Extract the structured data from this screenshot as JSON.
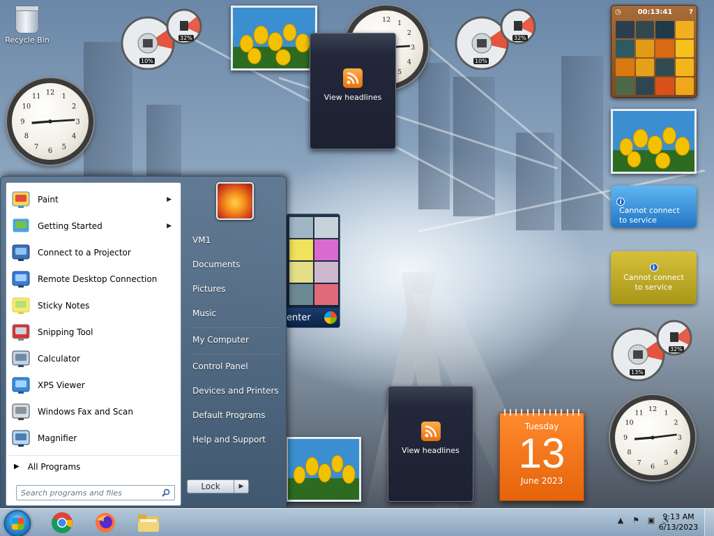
{
  "desktop": {
    "recycle_bin": "Recycle Bin"
  },
  "gadgets": {
    "meters": [
      {
        "cpu": "10%",
        "ram": "32%"
      },
      {
        "cpu": "10%",
        "ram": "32%"
      },
      {
        "cpu": "13%",
        "ram": "32%"
      }
    ],
    "feed_top": "View headlines",
    "feed_bottom": "View headlines",
    "puzzle_timer": "00:13:41",
    "weather_blue": "Cannot connect to service",
    "weather_gold": "Cannot connect to service",
    "calendar": {
      "weekday": "Tuesday",
      "day": "13",
      "month_year": "June 2023"
    },
    "media_center_label": "enter"
  },
  "start_menu": {
    "programs": [
      {
        "label": "Paint",
        "icon": "paint-icon",
        "submenu": true
      },
      {
        "label": "Getting Started",
        "icon": "getting-started-icon",
        "submenu": true
      },
      {
        "label": "Connect to a Projector",
        "icon": "projector-icon",
        "submenu": false
      },
      {
        "label": "Remote Desktop Connection",
        "icon": "remote-desktop-icon",
        "submenu": false
      },
      {
        "label": "Sticky Notes",
        "icon": "sticky-notes-icon",
        "submenu": false
      },
      {
        "label": "Snipping Tool",
        "icon": "snipping-tool-icon",
        "submenu": false
      },
      {
        "label": "Calculator",
        "icon": "calculator-icon",
        "submenu": false
      },
      {
        "label": "XPS Viewer",
        "icon": "xps-viewer-icon",
        "submenu": false
      },
      {
        "label": "Windows Fax and Scan",
        "icon": "fax-scan-icon",
        "submenu": false
      },
      {
        "label": "Magnifier",
        "icon": "magnifier-icon",
        "submenu": false
      }
    ],
    "all_programs": "All Programs",
    "search_placeholder": "Search programs and files",
    "right_items": [
      "VM1",
      "Documents",
      "Pictures",
      "Music",
      "My Computer",
      "Control Panel",
      "Devices and Printers",
      "Default Programs",
      "Help and Support"
    ],
    "lock_label": "Lock"
  },
  "taskbar": {
    "apps": [
      "chrome-icon",
      "firefox-icon",
      "file-explorer-icon"
    ],
    "time": "9:13 AM",
    "date": "6/13/2023"
  }
}
